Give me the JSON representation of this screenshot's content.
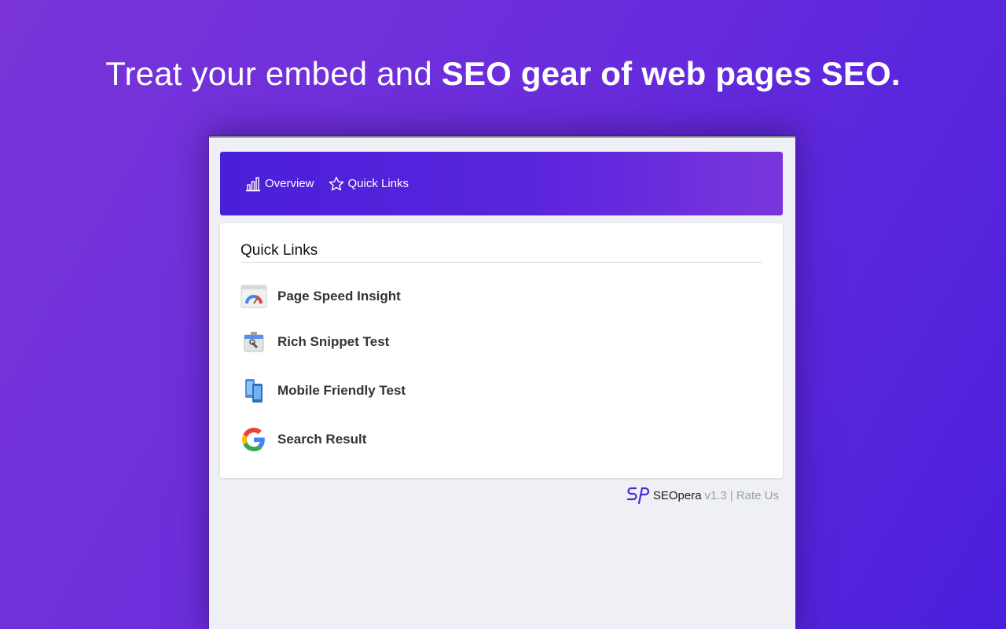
{
  "headline": {
    "normal": "Treat your embed and ",
    "bold": "SEO gear of web pages SEO."
  },
  "nav": {
    "tabs": [
      {
        "label": "Overview",
        "icon": "bar-chart-icon"
      },
      {
        "label": "Quick Links",
        "icon": "star-icon"
      }
    ]
  },
  "quick_links": {
    "title": "Quick Links",
    "items": [
      {
        "label": "Page Speed Insight",
        "icon": "page-speed-icon"
      },
      {
        "label": "Rich Snippet Test",
        "icon": "rich-snippet-icon"
      },
      {
        "label": "Mobile Friendly Test",
        "icon": "mobile-friendly-icon"
      },
      {
        "label": "Search Result",
        "icon": "google-icon"
      }
    ]
  },
  "footer": {
    "brand": "SEOpera",
    "version": "v1.3",
    "separator": "|",
    "rate": "Rate Us"
  },
  "colors": {
    "background_start": "#7a34d8",
    "background_end": "#4a1fdc",
    "nav_start": "#4a1fd8",
    "nav_end": "#7a36dc",
    "brand_logo": "#4a2ad8"
  }
}
